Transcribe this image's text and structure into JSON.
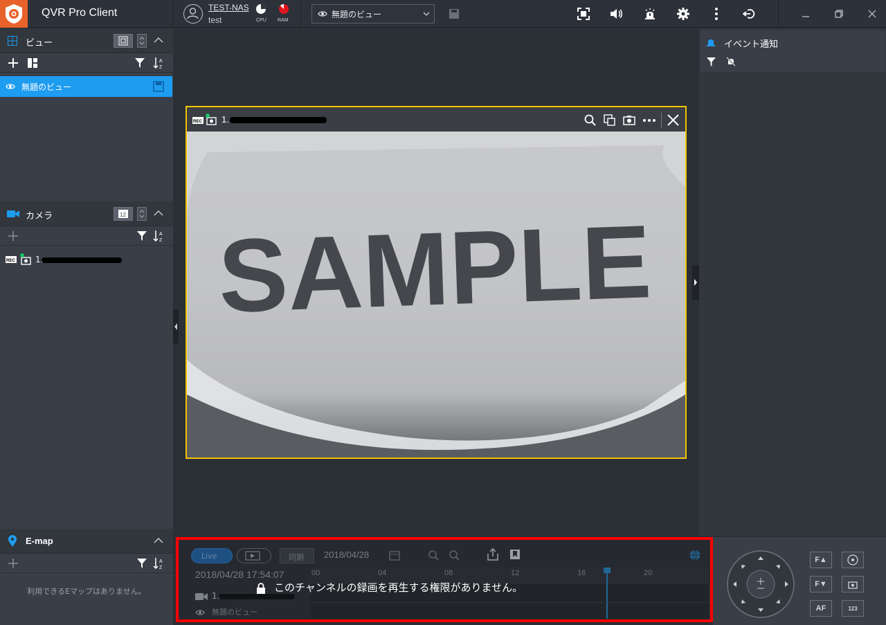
{
  "app": {
    "title": "QVR Pro Client"
  },
  "header": {
    "nas_name": "TEST-NAS",
    "user": "test",
    "cpu_label": "CPU",
    "ram_label": "RAM",
    "view_select_value": "無題のビュー"
  },
  "left": {
    "views_title": "ビュー",
    "view_items": [
      {
        "label": "無題のビュー"
      }
    ],
    "camera_title": "カメラ",
    "cameras": [
      {
        "label": "1."
      }
    ],
    "emap_title": "E-map",
    "emap_empty": "利用できるEマップはありません。"
  },
  "camera_tile": {
    "name": "1.",
    "rec_badge": "REC",
    "video_overlay_text": "SAMPLE"
  },
  "right": {
    "event_title": "イベント通知"
  },
  "playback": {
    "live_label": "Live",
    "sync_label": "同期",
    "date": "2018/04/28",
    "time": "2018/04/28 17:54:07",
    "ticks": [
      "00",
      "04",
      "08",
      "12",
      "16",
      "20"
    ],
    "camera_row": "1.",
    "view_row": "無題のビュー",
    "no_permission": "このチャンネルの録画を再生する権限がありません。"
  },
  "ptz": {
    "focus_up": "F▲",
    "focus_down": "F▼",
    "af": "AF",
    "preset": "123"
  },
  "colors": {
    "accent": "#1e9cf0",
    "logo": "#e8632c",
    "tile_border": "#f2c500",
    "highlight": "#ff0000"
  }
}
